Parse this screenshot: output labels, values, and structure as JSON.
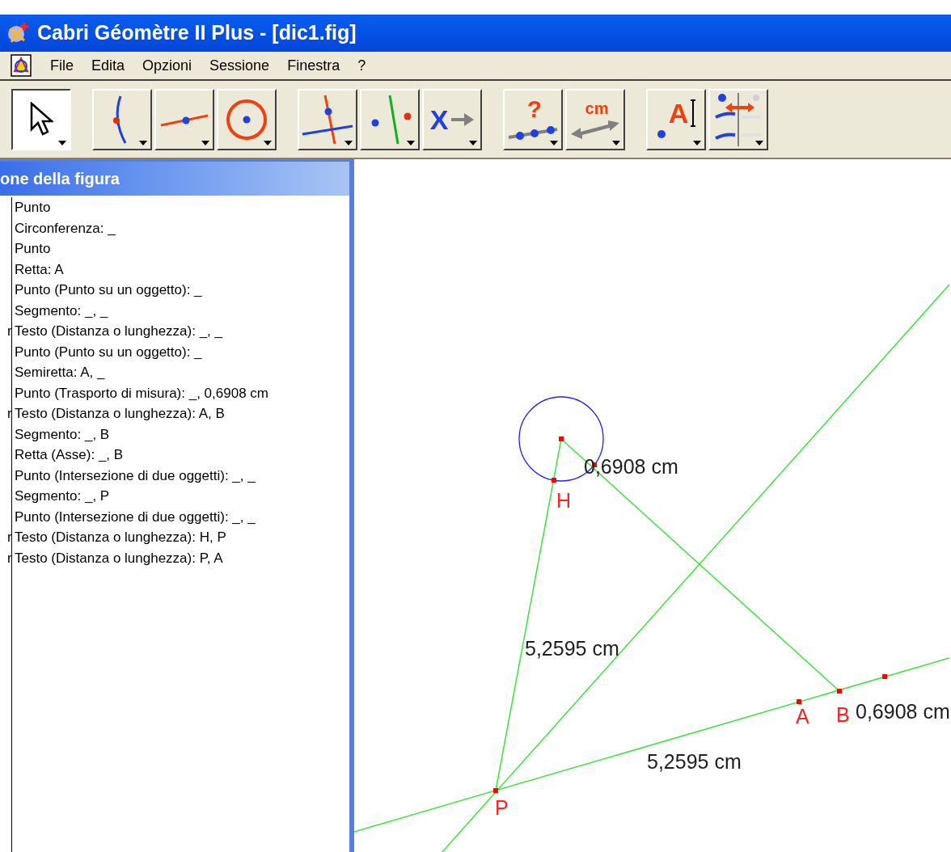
{
  "window": {
    "title": "Cabri Géomètre II Plus - [dic1.fig]"
  },
  "menu": [
    "File",
    "Edita",
    "Opzioni",
    "Sessione",
    "Finestra",
    "?"
  ],
  "toolbar": [
    [
      {
        "kind": "pointer",
        "selected": true
      }
    ],
    [
      {
        "kind": "point",
        "selected": false
      },
      {
        "kind": "line",
        "selected": false
      },
      {
        "kind": "circle",
        "selected": false
      }
    ],
    [
      {
        "kind": "perpendicular",
        "selected": false
      },
      {
        "kind": "symmetry",
        "selected": false
      },
      {
        "kind": "macro",
        "glyph": "X",
        "selected": false
      }
    ],
    [
      {
        "kind": "check",
        "glyph": "?",
        "selected": false
      },
      {
        "kind": "measure",
        "glyph": "cm",
        "selected": false
      }
    ],
    [
      {
        "kind": "label",
        "glyph": "A",
        "selected": false
      },
      {
        "kind": "attributes",
        "selected": false
      }
    ]
  ],
  "panel": {
    "title": "one della figura",
    "items": [
      {
        "text": "Punto"
      },
      {
        "text": "Circonferenza: _"
      },
      {
        "text": "Punto"
      },
      {
        "text": "Retta: A"
      },
      {
        "text": "Punto (Punto su un oggetto): _"
      },
      {
        "text": "Segmento: _, _"
      },
      {
        "prefix": "r",
        "text": "Testo (Distanza o lunghezza): _, _"
      },
      {
        "text": "Punto (Punto su un oggetto): _"
      },
      {
        "text": "Semiretta: A, _"
      },
      {
        "text": "Punto (Trasporto di misura): _, 0,6908 cm"
      },
      {
        "prefix": "r",
        "text": "Testo (Distanza o lunghezza): A, B"
      },
      {
        "text": "Segmento: _, B"
      },
      {
        "text": "Retta (Asse): _, B"
      },
      {
        "text": "Punto (Intersezione di due oggetti): _, _"
      },
      {
        "text": "Segmento: _, P"
      },
      {
        "text": "Punto (Intersezione di due oggetti): _, _"
      },
      {
        "prefix": "r",
        "text": "Testo (Distanza o lunghezza): H, P"
      },
      {
        "prefix": "r",
        "text": "Testo (Distanza o lunghezza): P, A"
      }
    ]
  },
  "canvas": {
    "labels": [
      {
        "kind": "point",
        "text": "H"
      },
      {
        "kind": "point",
        "text": "P"
      },
      {
        "kind": "point",
        "text": "A"
      },
      {
        "kind": "measure",
        "text": "0,6908 cm"
      },
      {
        "kind": "measure",
        "text": "5,2595 cm"
      },
      {
        "kind": "point",
        "text": "B"
      },
      {
        "kind": "measure",
        "text": "0,6908 cm"
      },
      {
        "kind": "measure",
        "text": "5,2595 cm"
      }
    ]
  }
}
